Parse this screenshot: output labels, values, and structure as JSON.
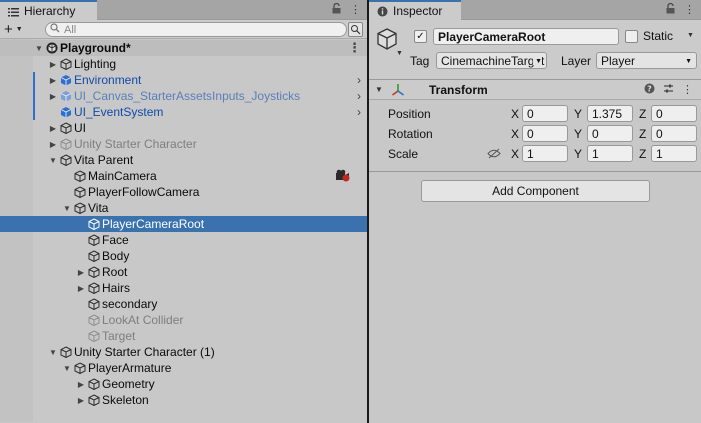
{
  "hierarchy": {
    "tab_label": "Hierarchy",
    "search_placeholder": "All",
    "scene": "Playground*",
    "items": [
      {
        "label": "Lighting",
        "depth": 1,
        "fold": "right",
        "style": "normal"
      },
      {
        "label": "Environment",
        "depth": 1,
        "fold": "right",
        "style": "prefab",
        "icon": "prefab",
        "bar": true,
        "arrow": true
      },
      {
        "label": "UI_Canvas_StarterAssetsInputs_Joysticks",
        "depth": 1,
        "fold": "right",
        "style": "prefab-inactive",
        "icon": "prefab-inactive",
        "bar": true,
        "arrow": true
      },
      {
        "label": "UI_EventSystem",
        "depth": 1,
        "fold": "none",
        "style": "prefab",
        "icon": "prefab",
        "bar": true,
        "arrow": true
      },
      {
        "label": "UI",
        "depth": 1,
        "fold": "right",
        "style": "normal"
      },
      {
        "label": "Unity Starter Character",
        "depth": 1,
        "fold": "right",
        "style": "inactive",
        "icon": "inactive"
      },
      {
        "label": "Vita Parent",
        "depth": 1,
        "fold": "down",
        "style": "normal"
      },
      {
        "label": "MainCamera",
        "depth": 2,
        "fold": "none",
        "style": "normal",
        "warn": true
      },
      {
        "label": "PlayerFollowCamera",
        "depth": 2,
        "fold": "none",
        "style": "normal"
      },
      {
        "label": "Vita",
        "depth": 2,
        "fold": "down",
        "style": "normal"
      },
      {
        "label": "PlayerCameraRoot",
        "depth": 3,
        "fold": "none",
        "style": "selected"
      },
      {
        "label": "Face",
        "depth": 3,
        "fold": "none",
        "style": "normal"
      },
      {
        "label": "Body",
        "depth": 3,
        "fold": "none",
        "style": "normal"
      },
      {
        "label": "Root",
        "depth": 3,
        "fold": "right",
        "style": "normal"
      },
      {
        "label": "Hairs",
        "depth": 3,
        "fold": "right",
        "style": "normal"
      },
      {
        "label": "secondary",
        "depth": 3,
        "fold": "none",
        "style": "normal"
      },
      {
        "label": "LookAt Collider",
        "depth": 3,
        "fold": "none",
        "style": "inactive",
        "icon": "inactive"
      },
      {
        "label": "Target",
        "depth": 3,
        "fold": "none",
        "style": "inactive",
        "icon": "inactive"
      },
      {
        "label": "Unity Starter Character (1)",
        "depth": 1,
        "fold": "down",
        "style": "normal"
      },
      {
        "label": "PlayerArmature",
        "depth": 2,
        "fold": "down",
        "style": "normal"
      },
      {
        "label": "Geometry",
        "depth": 3,
        "fold": "right",
        "style": "normal"
      },
      {
        "label": "Skeleton",
        "depth": 3,
        "fold": "right",
        "style": "normal"
      }
    ]
  },
  "inspector": {
    "tab_label": "Inspector",
    "object_name": "PlayerCameraRoot",
    "active_checked": "✓",
    "static_label": "Static",
    "tag_label": "Tag",
    "tag_value": "CinemachineTarget",
    "layer_label": "Layer",
    "layer_value": "Player",
    "transform": {
      "title": "Transform",
      "position": {
        "label": "Position",
        "x": "0",
        "y": "1.375",
        "z": "0"
      },
      "rotation": {
        "label": "Rotation",
        "x": "0",
        "y": "0",
        "z": "0"
      },
      "scale": {
        "label": "Scale",
        "x": "1",
        "y": "1",
        "z": "1"
      },
      "axis_x": "X",
      "axis_y": "Y",
      "axis_z": "Z"
    },
    "add_component_label": "Add Component"
  },
  "colors": {
    "selection": "#3a72b0",
    "prefab_text": "#0f4ba8",
    "panel_bg": "#c8c8c8"
  }
}
